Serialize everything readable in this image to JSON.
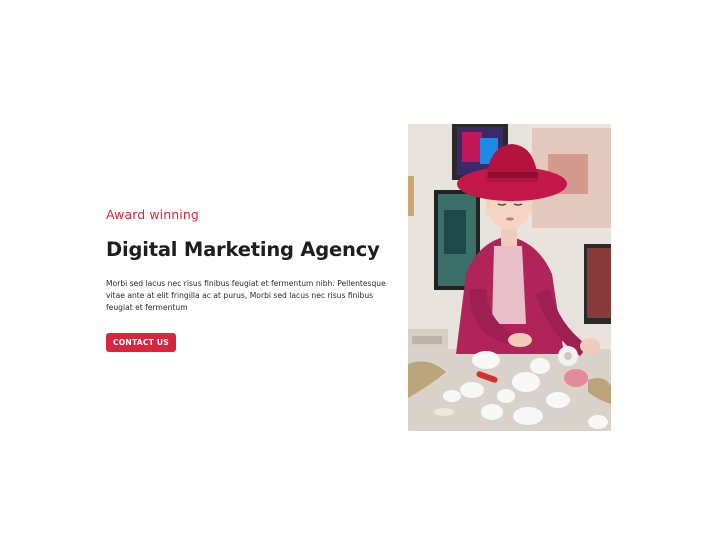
{
  "hero": {
    "eyebrow": "Award winning",
    "headline": "Digital Marketing Agency",
    "body": "Morbi sed lacus nec risus finibus feugiat et fermentum nibh. Pellentesque vitae ante at elit fringilla ac at purus, Morbi sed lacus nec risus finibus feugiat et fermentum",
    "cta_label": "CONTACT US"
  },
  "colors": {
    "accent": "#d7263d",
    "heading": "#1e1e1e",
    "background": "#ffffff"
  },
  "image": {
    "semantic": "woman-in-red-hat-crafting-photo"
  }
}
